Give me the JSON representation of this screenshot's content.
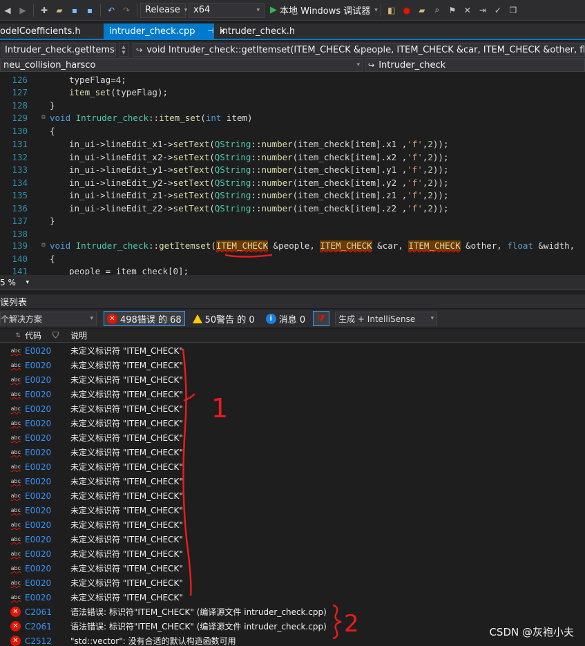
{
  "toolbar": {
    "config": "Release",
    "platform": "x64",
    "run_label": "本地 Windows 调试器"
  },
  "tabs": [
    {
      "label": "odelCoefficients.h"
    },
    {
      "label": "intruder_check.cpp",
      "active": true
    },
    {
      "label": "intruder_check.h"
    }
  ],
  "nav1": {
    "scope": "Intruder_check.getItemse",
    "member": "void Intruder_check::getItemset(ITEM_CHECK &people, ITEM_CHECK &car, ITEM_CHECK &other, float &width,"
  },
  "nav2": {
    "project": "neu_collision_harsco",
    "class": "Intruder_check"
  },
  "code_lines": [
    {
      "n": "126"
    },
    {
      "n": "127"
    },
    {
      "n": "128"
    },
    {
      "n": "129"
    },
    {
      "n": "130"
    },
    {
      "n": "131"
    },
    {
      "n": "132"
    },
    {
      "n": "133"
    },
    {
      "n": "134"
    },
    {
      "n": "135"
    },
    {
      "n": "136"
    },
    {
      "n": "137"
    },
    {
      "n": "138"
    },
    {
      "n": "139"
    },
    {
      "n": "140"
    },
    {
      "n": "141"
    }
  ],
  "code": {
    "l126": "typeFlag=4;",
    "l127_fn": "item_set",
    "l127_rest": "(typeFlag);",
    "l129_void": "void",
    "l129_cls": "Intruder_check",
    "l129_sep": "::",
    "l129_fn": "item_set",
    "l129_rest_a": "(",
    "l129_int": "int",
    "l129_rest_b": " item)",
    "set_lines": [
      {
        "field": "lineEdit_x1",
        "member": "x1"
      },
      {
        "field": "lineEdit_x2",
        "member": "x2"
      },
      {
        "field": "lineEdit_y1",
        "member": "y1"
      },
      {
        "field": "lineEdit_y2",
        "member": "y2"
      },
      {
        "field": "lineEdit_z1",
        "member": "z1"
      },
      {
        "field": "lineEdit_z2",
        "member": "z2"
      }
    ],
    "l139_fn": "getItemset",
    "l139_t1": "ITEM_CHECK",
    "l139_p1": " &people, ",
    "l139_t2": "ITEM_CHECK",
    "l139_p2": " &car, ",
    "l139_t3": "ITEM_CHECK",
    "l139_p3": " &other, ",
    "l139_float": "float",
    "l139_p4": " &width,",
    "l141": "people = item_check[0];"
  },
  "zoom": "5 %",
  "panel": {
    "title": "误列表",
    "scope": "个解决方案",
    "errors": "498错误 的 68",
    "warnings": "50警告 的 0",
    "messages": "消息 0",
    "build_filter": "生成 + IntelliSense",
    "col_code": "代码",
    "col_desc": "说明"
  },
  "error_rows": [
    {
      "code": "E0020",
      "desc": "未定义标识符 \"ITEM_CHECK\"",
      "kind": "intellisense"
    },
    {
      "code": "E0020",
      "desc": "未定义标识符 \"ITEM_CHECK\"",
      "kind": "intellisense"
    },
    {
      "code": "E0020",
      "desc": "未定义标识符 \"ITEM_CHECK\"",
      "kind": "intellisense"
    },
    {
      "code": "E0020",
      "desc": "未定义标识符 \"ITEM_CHECK\"",
      "kind": "intellisense"
    },
    {
      "code": "E0020",
      "desc": "未定义标识符 \"ITEM_CHECK\"",
      "kind": "intellisense"
    },
    {
      "code": "E0020",
      "desc": "未定义标识符 \"ITEM_CHECK\"",
      "kind": "intellisense"
    },
    {
      "code": "E0020",
      "desc": "未定义标识符 \"ITEM_CHECK\"",
      "kind": "intellisense"
    },
    {
      "code": "E0020",
      "desc": "未定义标识符 \"ITEM_CHECK\"",
      "kind": "intellisense"
    },
    {
      "code": "E0020",
      "desc": "未定义标识符 \"ITEM_CHECK\"",
      "kind": "intellisense"
    },
    {
      "code": "E0020",
      "desc": "未定义标识符 \"ITEM_CHECK\"",
      "kind": "intellisense"
    },
    {
      "code": "E0020",
      "desc": "未定义标识符 \"ITEM_CHECK\"",
      "kind": "intellisense"
    },
    {
      "code": "E0020",
      "desc": "未定义标识符 \"ITEM_CHECK\"",
      "kind": "intellisense"
    },
    {
      "code": "E0020",
      "desc": "未定义标识符 \"ITEM_CHECK\"",
      "kind": "intellisense"
    },
    {
      "code": "E0020",
      "desc": "未定义标识符 \"ITEM_CHECK\"",
      "kind": "intellisense"
    },
    {
      "code": "E0020",
      "desc": "未定义标识符 \"ITEM_CHECK\"",
      "kind": "intellisense"
    },
    {
      "code": "E0020",
      "desc": "未定义标识符 \"ITEM_CHECK\"",
      "kind": "intellisense"
    },
    {
      "code": "E0020",
      "desc": "未定义标识符 \"ITEM_CHECK\"",
      "kind": "intellisense"
    },
    {
      "code": "E0020",
      "desc": "未定义标识符 \"ITEM_CHECK\"",
      "kind": "intellisense"
    },
    {
      "code": "C2061",
      "desc": "语法错误: 标识符\"ITEM_CHECK\" (编译源文件 intruder_check.cpp)",
      "kind": "build"
    },
    {
      "code": "C2061",
      "desc": "语法错误: 标识符\"ITEM_CHECK\" (编译源文件 intruder_check.cpp)",
      "kind": "build"
    },
    {
      "code": "C2512",
      "desc": "\"std::vector\": 没有合适的默认构造函数可用",
      "kind": "build"
    }
  ],
  "annotations": {
    "mark1": "1",
    "mark2": "2"
  },
  "watermark": "CSDN @灰袍小夫",
  "colors": {
    "accent": "#007acc",
    "error_red": "#e51400",
    "link_blue": "#3794ff",
    "annotation_red": "#e81c1c"
  }
}
